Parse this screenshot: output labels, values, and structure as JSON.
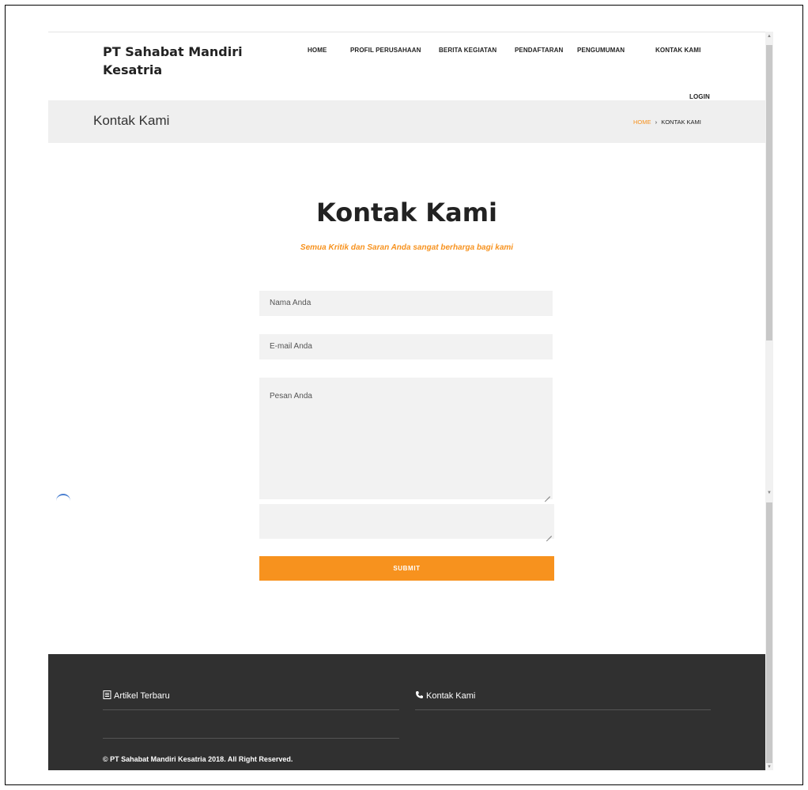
{
  "header": {
    "brand": "PT Sahabat Mandiri Kesatria",
    "nav": [
      "HOME",
      "PROFIL PERUSAHAAN",
      "BERITA KEGIATAN",
      "PENDAFTARAN",
      "PENGUMUMAN",
      "KONTAK KAMI"
    ],
    "login": "LOGIN"
  },
  "titlebar": {
    "title": "Kontak Kami",
    "breadcrumb_home": "HOME",
    "breadcrumb_separator": "›",
    "breadcrumb_current": "KONTAK KAMI"
  },
  "contact": {
    "heading": "Kontak Kami",
    "subtitle": "Semua Kritik dan Saran Anda sangat berharga bagi kami",
    "name_placeholder": "Nama Anda",
    "email_placeholder": "E-mail Anda",
    "message_placeholder": "Pesan Anda",
    "submit_label": "SUBMIT"
  },
  "footer": {
    "col1_title": "Artikel Terbaru",
    "col2_title": "Kontak Kami",
    "copyright": "© PT Sahabat Mandiri Kesatria 2018. All Right Reserved."
  },
  "colors": {
    "accent": "#f7921e",
    "footer_bg": "#303030",
    "titlebar_bg": "#efefef",
    "field_bg": "#f2f2f2"
  },
  "icons": {
    "footer_col1": "document-icon",
    "footer_col2": "phone-icon"
  }
}
